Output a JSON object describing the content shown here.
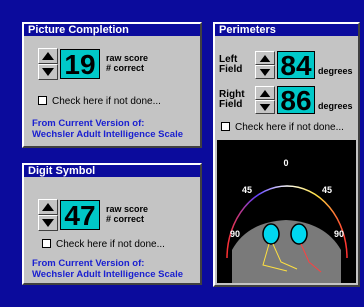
{
  "picture_completion": {
    "title": "Picture Completion",
    "score": "19",
    "raw_label_1": "raw score",
    "raw_label_2": "# correct",
    "check_label": "Check here if not done...",
    "source_1": "From Current Version of:",
    "source_2": "Wechsler Adult Intelligence Scale"
  },
  "digit_symbol": {
    "title": "Digit Symbol",
    "score": "47",
    "raw_label_1": "raw score",
    "raw_label_2": "# correct",
    "check_label": "Check here if not done...",
    "source_1": "From Current Version of:",
    "source_2": "Wechsler Adult Intelligence Scale"
  },
  "perimeters": {
    "title": "Perimeters",
    "left_label_1": "Left",
    "left_label_2": "Field",
    "left_value": "84",
    "right_label_1": "Right",
    "right_label_2": "Field",
    "right_value": "86",
    "unit": "degrees",
    "check_label": "Check here if not done...",
    "diagram": {
      "top_label": "0",
      "left_45": "45",
      "right_45": "45",
      "left_90": "90",
      "right_90": "90"
    }
  },
  "colors": {
    "background": "#0b0b9c",
    "panel": "#c4c4c4",
    "score_box": "#00c8c8",
    "source_text": "#1a20d0"
  }
}
